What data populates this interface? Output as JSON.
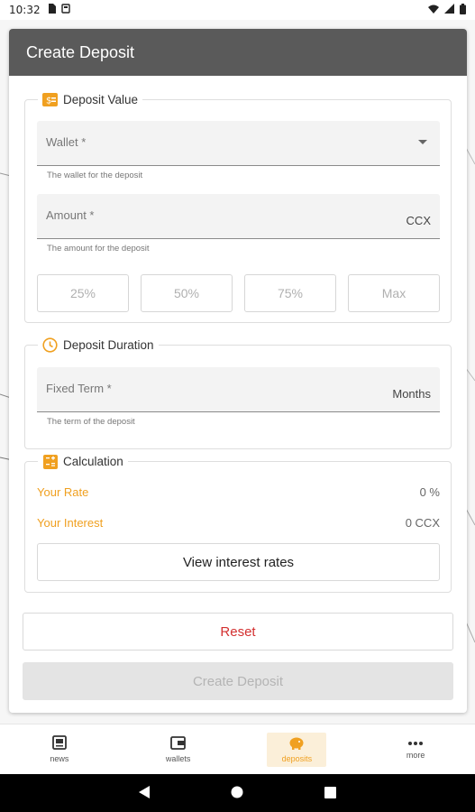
{
  "status_bar": {
    "time": "10:32"
  },
  "header": {
    "title": "Create Deposit"
  },
  "deposit_value": {
    "legend": "Deposit Value",
    "wallet": {
      "label": "Wallet *",
      "hint": "The wallet for the deposit"
    },
    "amount": {
      "label": "Amount *",
      "suffix": "CCX",
      "hint": "The amount for the deposit"
    },
    "percent_buttons": [
      "25%",
      "50%",
      "75%",
      "Max"
    ]
  },
  "deposit_duration": {
    "legend": "Deposit Duration",
    "term": {
      "label": "Fixed Term *",
      "suffix": "Months",
      "hint": "The term of the deposit"
    }
  },
  "calculation": {
    "legend": "Calculation",
    "rate_label": "Your Rate",
    "rate_value": "0 %",
    "interest_label": "Your Interest",
    "interest_value": "0 CCX",
    "view_rates_label": "View interest rates"
  },
  "actions": {
    "reset_label": "Reset",
    "create_label": "Create Deposit"
  },
  "bottom_nav": {
    "items": [
      {
        "label": "news",
        "icon": "news-icon"
      },
      {
        "label": "wallets",
        "icon": "wallet-icon"
      },
      {
        "label": "deposits",
        "icon": "piggy-bank-icon",
        "active": true
      },
      {
        "label": "more",
        "icon": "more-icon"
      }
    ]
  },
  "colors": {
    "accent": "#f0a020",
    "header_bg": "#5a5a5a",
    "reset_text": "#d33030"
  }
}
